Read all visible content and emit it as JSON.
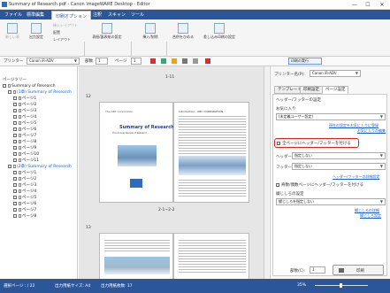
{
  "window": {
    "title": "Summary of Research.pdf - Canon imageWARE Desktop - Editor",
    "controls": {
      "minimize": "—",
      "maximize": "☐",
      "close": "✕"
    }
  },
  "menu": {
    "items": [
      "ファイル",
      "標準編集",
      "印刷オプション",
      "注釈",
      "スキャン",
      "ツール"
    ],
    "active_index": 2
  },
  "ribbon": {
    "groups": [
      {
        "label": "表"
      },
      {
        "label": "表紙/裏表紙"
      },
      {
        "label": "印刷"
      },
      {
        "label": "ツール"
      }
    ],
    "buttons": {
      "new_page": "新しい表",
      "output_settings": "出力設定",
      "insert_layout": "挿入レイアウト",
      "layout": "配置",
      "layout_sub": "レイアウト",
      "cover_settings": "表紙/裏表紙の設定",
      "insert_remove": "挿入/削除",
      "merge": "合併をひめる",
      "reprint": "差し込み印刷の設定"
    }
  },
  "toolrow": {
    "printer_label": "プリンター",
    "printer_value": "Canon iR-ADV",
    "copies_label": "部数",
    "copies_value": "1",
    "page_label": "ページ",
    "page_value": "1",
    "print_settings_button": "印刷の実行"
  },
  "left_panel": {
    "header": "ページツリー",
    "tree": [
      {
        "label": "Summary of Research",
        "level": 0,
        "type": "doc"
      },
      {
        "label": "(1章) Summary of Research",
        "level": 1,
        "type": "chapter",
        "color": "#1f5fbf"
      },
      {
        "label": "ページ1",
        "level": 2,
        "type": "page"
      },
      {
        "label": "ページ2",
        "level": 2,
        "type": "page"
      },
      {
        "label": "ページ3",
        "level": 2,
        "type": "page"
      },
      {
        "label": "ページ4",
        "level": 2,
        "type": "page"
      },
      {
        "label": "ページ5",
        "level": 2,
        "type": "page"
      },
      {
        "label": "ページ6",
        "level": 2,
        "type": "page"
      },
      {
        "label": "ページ7",
        "level": 2,
        "type": "page"
      },
      {
        "label": "ページ8",
        "level": 2,
        "type": "page"
      },
      {
        "label": "ページ9",
        "level": 2,
        "type": "page"
      },
      {
        "label": "ページ10",
        "level": 2,
        "type": "page"
      },
      {
        "label": "ページ11",
        "level": 2,
        "type": "page"
      },
      {
        "label": "(2章) Summary of Research",
        "level": 1,
        "type": "chapter",
        "color": "#1f5fbf"
      },
      {
        "label": "ページ1",
        "level": 2,
        "type": "page"
      },
      {
        "label": "ページ2",
        "level": 2,
        "type": "page"
      },
      {
        "label": "ページ3",
        "level": 2,
        "type": "page"
      },
      {
        "label": "ページ4",
        "level": 2,
        "type": "page"
      },
      {
        "label": "ページ5",
        "level": 2,
        "type": "page"
      },
      {
        "label": "ページ6",
        "level": 2,
        "type": "page"
      },
      {
        "label": "ページ7",
        "level": 2,
        "type": "page"
      },
      {
        "label": "ページ8",
        "level": 2,
        "type": "page"
      }
    ]
  },
  "center": {
    "page_label_top": "1-11",
    "page_num_12": "12",
    "spread_label": "2-1~2-2",
    "page_num_13": "13",
    "doc": {
      "company": "The ABC Corporation",
      "title": "Summary of Research",
      "subtitle": "The Annual Review of Research",
      "intro_heading": "Introduction - ABC CORPORATION",
      "body_line": "Lorem ipsum dolor sit amet consectetur adipiscing elit sed do eiusmod"
    }
  },
  "right_panel": {
    "printer_label": "プリンター名(P):",
    "printer_value": "Canon iR-ADV",
    "tabs": [
      "テンプレート",
      "印刷設定",
      "ページ設定"
    ],
    "active_tab": 2,
    "section_title": "ヘッダー/フッターの設定",
    "favorites_label": "お気に入り",
    "favorites_value": "(未定義ユーザー設定)",
    "link_register": "現在の設定をお気に入りに登録",
    "link_edit": "お気に入りの編集",
    "checkbox_all_pages": "全ページにヘッダー/フッターを付ける",
    "header_label": "ヘッダー:",
    "header_value": "指定しない",
    "footer_label": "フッター:",
    "footer_value": "指定しない",
    "link_hf_detail": "ヘッダー/フッターの詳細設定",
    "checkbox_odd_even": "奇数/偶数ページにヘッダー/フッターを付ける",
    "margin_section": "綴じしろの設定",
    "margin_value": "綴じしろを指定しない",
    "link_margin_detail": "綴じしろの詳細",
    "link_margin_settings": "綴じしろ設定",
    "copies_label": "部数(C):",
    "copies_value": "1",
    "print_button": "印刷",
    "highlight_color": "#e0201b"
  },
  "statusbar": {
    "selected_page": "選択ページ : / 22",
    "output_size": "出力用紙サイズ: A4",
    "output_pages": "出力用紙枚数: 17",
    "zoom": "35%"
  },
  "colors": {
    "accent": "#2b579a",
    "link": "#1f5fbf",
    "highlight": "#e0201b"
  }
}
